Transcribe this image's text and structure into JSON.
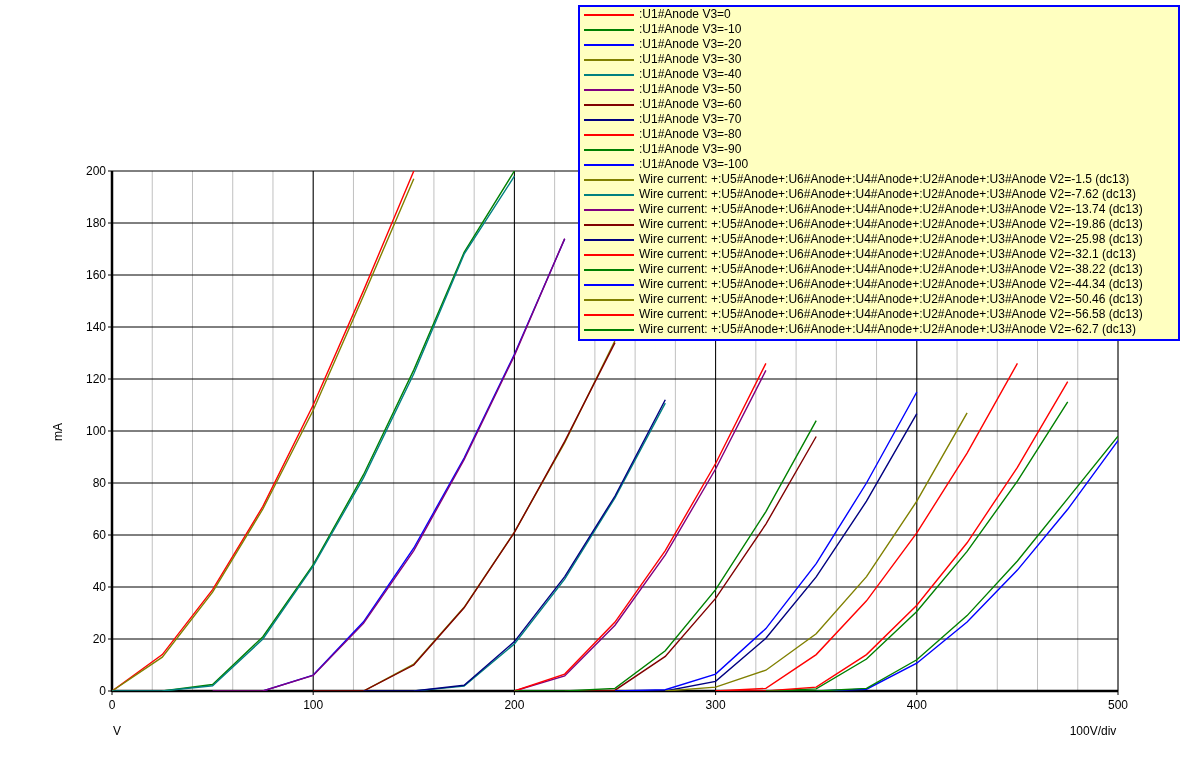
{
  "chart_data": {
    "type": "line",
    "xlabel": "V",
    "ylabel": "mA",
    "xlim": [
      0,
      500
    ],
    "ylim": [
      0,
      200
    ],
    "grid": true,
    "xticks": [
      0,
      100,
      200,
      300,
      400,
      500
    ],
    "yticks": [
      0,
      20,
      40,
      60,
      80,
      100,
      120,
      140,
      160,
      180,
      200
    ],
    "annotations": [
      {
        "text": "100V/div"
      }
    ],
    "x": [
      0,
      25,
      50,
      75,
      100,
      125,
      150,
      175,
      200,
      225,
      250,
      275,
      300,
      325,
      350,
      375,
      400,
      425,
      450,
      475,
      500
    ],
    "series": [
      {
        "name": ":U1#Anode V3=0",
        "color": "#ff0000",
        "values": [
          0,
          14,
          39,
          71,
          110,
          154,
          200,
          null,
          null,
          null,
          null,
          null,
          null,
          null,
          null,
          null,
          null,
          null,
          null,
          null,
          null
        ]
      },
      {
        "name": ":U1#Anode V3=-10",
        "color": "#008000",
        "values": [
          null,
          0,
          2.5,
          20.9,
          48.6,
          83.2,
          123.5,
          168.7,
          200,
          null,
          null,
          null,
          null,
          null,
          null,
          null,
          null,
          null,
          null,
          null,
          null
        ]
      },
      {
        "name": ":U1#Anode V3=-20",
        "color": "#0000ff",
        "values": [
          null,
          null,
          null,
          0,
          6.1,
          26.6,
          55,
          89.6,
          129.5,
          173.9,
          null,
          null,
          null,
          null,
          null,
          null,
          null,
          null,
          null,
          null,
          null
        ]
      },
      {
        "name": ":U1#Anode V3=-30",
        "color": "#808000",
        "values": [
          null,
          null,
          null,
          null,
          null,
          0,
          10.3,
          32.2,
          61.1,
          95.5,
          134.8,
          null,
          null,
          null,
          null,
          null,
          null,
          null,
          null,
          null,
          null
        ]
      },
      {
        "name": ":U1#Anode V3=-40",
        "color": "#008080",
        "values": [
          null,
          null,
          null,
          null,
          null,
          null,
          0,
          1.9,
          18.1,
          43,
          74.3,
          110.7,
          null,
          null,
          null,
          null,
          null,
          null,
          null,
          null,
          null
        ]
      },
      {
        "name": ":U1#Anode V3=-50",
        "color": "#800080",
        "values": [
          null,
          null,
          null,
          null,
          null,
          null,
          null,
          null,
          0,
          5.8,
          25.3,
          52.4,
          85.4,
          123.3,
          null,
          null,
          null,
          null,
          null,
          null,
          null
        ]
      },
      {
        "name": ":U1#Anode V3=-60",
        "color": "#800000",
        "values": [
          null,
          null,
          null,
          null,
          null,
          null,
          null,
          null,
          null,
          0,
          0.3,
          13.3,
          35.6,
          64.2,
          97.9,
          null,
          null,
          null,
          null,
          null,
          null
        ]
      },
      {
        "name": ":U1#Anode V3=-70",
        "color": "#000080",
        "values": [
          null,
          null,
          null,
          null,
          null,
          null,
          null,
          null,
          null,
          null,
          null,
          0,
          3.7,
          20.3,
          43.9,
          73,
          106.7,
          null,
          null,
          null,
          null
        ]
      },
      {
        "name": ":U1#Anode V3=-80",
        "color": "#ff0000",
        "values": [
          null,
          null,
          null,
          null,
          null,
          null,
          null,
          null,
          null,
          null,
          null,
          null,
          0,
          1,
          14,
          34.7,
          60.8,
          91.5,
          126,
          null,
          null
        ]
      },
      {
        "name": ":U1#Anode V3=-90",
        "color": "#008000",
        "values": [
          null,
          null,
          null,
          null,
          null,
          null,
          null,
          null,
          null,
          null,
          null,
          null,
          null,
          0,
          0.8,
          12.3,
          30.6,
          53.7,
          80.7,
          111.2,
          null
        ]
      },
      {
        "name": ":U1#Anode V3=-100",
        "color": "#0000ff",
        "values": [
          null,
          null,
          null,
          null,
          null,
          null,
          null,
          null,
          null,
          null,
          null,
          null,
          null,
          null,
          0,
          0.7,
          10.7,
          26.5,
          46.5,
          69.9,
          96.3
        ]
      },
      {
        "name": "Wire current: +:U5#Anode+:U6#Anode+:U4#Anode+:U2#Anode+:U3#Anode V2=-1.5 (dc13)",
        "color": "#808000",
        "values": [
          0,
          13,
          38,
          70,
          108,
          152,
          197,
          null,
          null,
          null,
          null,
          null,
          null,
          null,
          null,
          null,
          null,
          null,
          null,
          null,
          null
        ]
      },
      {
        "name": "Wire current: +:U5#Anode+:U6#Anode+:U4#Anode+:U2#Anode+:U3#Anode V2=-7.62 (dc13)",
        "color": "#008080",
        "values": [
          0,
          0,
          2,
          20,
          48,
          82,
          122,
          168,
          198,
          null,
          null,
          null,
          null,
          null,
          null,
          null,
          null,
          null,
          null,
          null,
          null
        ]
      },
      {
        "name": "Wire current: +:U5#Anode+:U6#Anode+:U4#Anode+:U2#Anode+:U3#Anode V2=-13.74 (dc13)",
        "color": "#800080",
        "values": [
          null,
          null,
          0,
          0,
          6,
          26,
          54,
          89,
          129,
          174,
          null,
          null,
          null,
          null,
          null,
          null,
          null,
          null,
          null,
          null,
          null
        ]
      },
      {
        "name": "Wire current: +:U5#Anode+:U6#Anode+:U4#Anode+:U2#Anode+:U3#Anode V2=-19.86 (dc13)",
        "color": "#800000",
        "values": [
          null,
          null,
          null,
          null,
          0,
          0,
          10,
          32,
          61,
          96,
          134,
          null,
          null,
          null,
          null,
          null,
          null,
          null,
          null,
          null,
          null
        ]
      },
      {
        "name": "Wire current: +:U5#Anode+:U6#Anode+:U4#Anode+:U2#Anode+:U3#Anode V2=-25.98 (dc13)",
        "color": "#000080",
        "values": [
          null,
          null,
          null,
          null,
          null,
          0,
          0,
          2.2,
          19,
          44,
          75,
          112,
          null,
          null,
          null,
          null,
          null,
          null,
          null,
          null,
          null
        ]
      },
      {
        "name": "Wire current: +:U5#Anode+:U6#Anode+:U4#Anode+:U2#Anode+:U3#Anode V2=-32.1 (dc13)",
        "color": "#ff0000",
        "values": [
          null,
          null,
          null,
          null,
          null,
          null,
          null,
          null,
          0,
          6.5,
          26.5,
          54,
          87.5,
          126,
          null,
          null,
          null,
          null,
          null,
          null,
          null
        ]
      },
      {
        "name": "Wire current: +:U5#Anode+:U6#Anode+:U4#Anode+:U2#Anode+:U3#Anode V2=-38.22 (dc13)",
        "color": "#008000",
        "values": [
          null,
          null,
          null,
          null,
          null,
          null,
          null,
          null,
          0,
          0,
          1,
          15.5,
          39,
          69,
          104,
          null,
          null,
          null,
          null,
          null,
          null
        ]
      },
      {
        "name": "Wire current: +:U5#Anode+:U6#Anode+:U4#Anode+:U2#Anode+:U3#Anode V2=-44.34 (dc13)",
        "color": "#0000ff",
        "values": [
          null,
          null,
          null,
          null,
          null,
          null,
          null,
          null,
          null,
          null,
          0,
          0.5,
          6.5,
          24,
          49,
          80,
          115,
          null,
          null,
          null,
          null
        ]
      },
      {
        "name": "Wire current: +:U5#Anode+:U6#Anode+:U4#Anode+:U2#Anode+:U3#Anode V2=-50.46 (dc13)",
        "color": "#808000",
        "values": [
          null,
          null,
          null,
          null,
          null,
          null,
          null,
          null,
          null,
          null,
          null,
          0,
          1.5,
          8,
          22,
          44,
          73,
          107,
          null,
          null,
          null
        ]
      },
      {
        "name": "Wire current: +:U5#Anode+:U6#Anode+:U4#Anode+:U2#Anode+:U3#Anode V2=-56.58 (dc13)",
        "color": "#ff0000",
        "values": [
          null,
          null,
          null,
          null,
          null,
          null,
          null,
          null,
          null,
          null,
          null,
          null,
          0,
          0,
          1.5,
          14,
          33,
          57,
          86,
          119,
          null
        ]
      },
      {
        "name": "Wire current: +:U5#Anode+:U6#Anode+:U4#Anode+:U2#Anode+:U3#Anode V2=-62.7 (dc13)",
        "color": "#008000",
        "values": [
          null,
          null,
          null,
          null,
          null,
          null,
          null,
          null,
          null,
          null,
          null,
          null,
          null,
          0,
          0,
          1,
          12,
          29,
          50,
          74,
          98
        ]
      }
    ]
  }
}
